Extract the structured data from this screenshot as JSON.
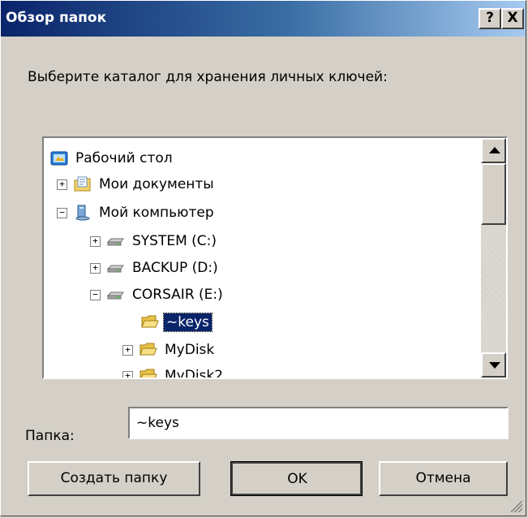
{
  "window": {
    "title": "Обзор папок",
    "help_button": "?",
    "close_button": "X"
  },
  "prompt": "Выберите каталог для хранения личных ключей:",
  "tree": {
    "items": [
      {
        "label": "Рабочий стол",
        "icon": "desktop-icon",
        "expander": ""
      },
      {
        "label": "Мои документы",
        "icon": "my-documents-icon",
        "expander": "+"
      },
      {
        "label": "Мой компьютер",
        "icon": "my-computer-icon",
        "expander": "−"
      },
      {
        "label": "SYSTEM (C:)",
        "icon": "drive-icon",
        "expander": "+"
      },
      {
        "label": "BACKUP (D:)",
        "icon": "drive-icon",
        "expander": "+"
      },
      {
        "label": "CORSAIR (E:)",
        "icon": "drive-icon",
        "expander": "−"
      },
      {
        "label": "~keys",
        "icon": "folder-icon",
        "expander": "",
        "selected": true
      },
      {
        "label": "MyDisk",
        "icon": "folder-icon",
        "expander": "+"
      },
      {
        "label": "MyDisk2",
        "icon": "folder-icon",
        "expander": "+"
      }
    ]
  },
  "folder": {
    "label": "Папка:",
    "value": "~keys"
  },
  "buttons": {
    "create_folder": "Создать папку",
    "ok": "OK",
    "cancel": "Отмена"
  },
  "colors": {
    "titlebar_start": "#0a246a",
    "titlebar_end": "#a6caf0",
    "selection": "#0a246a",
    "dialog_bg": "#d4d0c8"
  }
}
